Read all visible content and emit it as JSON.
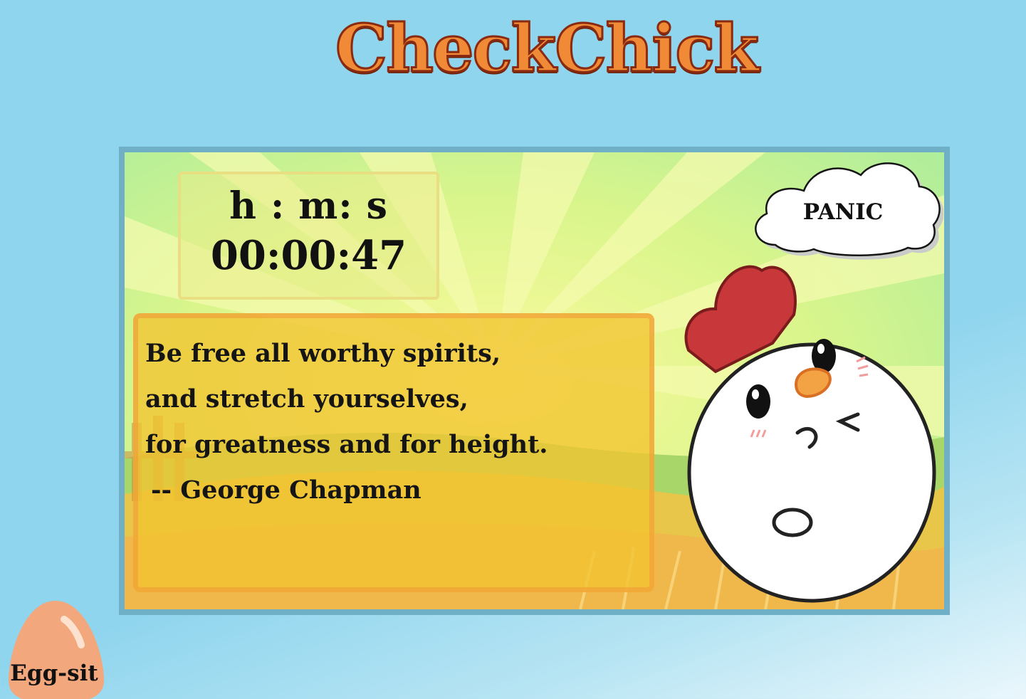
{
  "app": {
    "title": "CheckChick"
  },
  "timer": {
    "format_label": "h : m: s",
    "value": "00:00:47"
  },
  "quote": {
    "lines": [
      "Be free all worthy spirits,",
      "and stretch yourselves,",
      "for greatness and for height."
    ],
    "author": " -- George Chapman"
  },
  "panic": {
    "label": "PANIC"
  },
  "exit": {
    "label": "Egg-sit"
  },
  "colors": {
    "background": "#8fd5ee",
    "title_fill": "#f08a37",
    "title_outline": "#8a2a10",
    "panel_border": "#6fb0c6",
    "quote_box": "#f2c430",
    "comb": "#c8383a",
    "beak": "#f4a344",
    "egg": "#f3a77c"
  },
  "icons": {
    "panic": "cloud-icon",
    "mascot": "chick-icon",
    "exit": "egg-icon",
    "background": "sunburst-farm-scene"
  }
}
